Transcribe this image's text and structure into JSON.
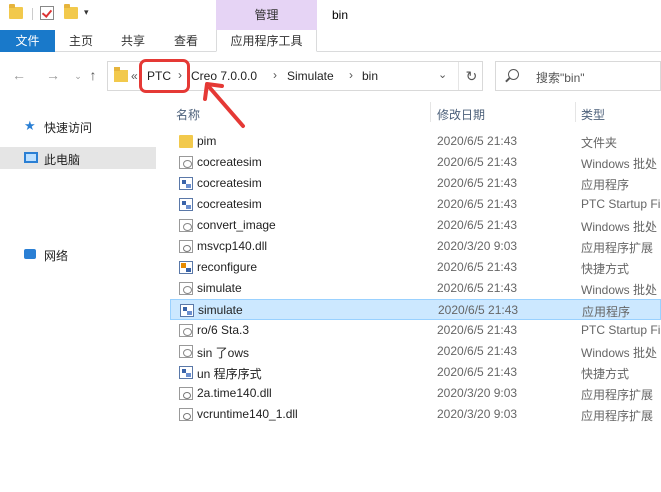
{
  "titlebar": {
    "manage_tab": "管理",
    "window_title": "bin"
  },
  "ribbon": {
    "tabs": [
      "文件",
      "主页",
      "共享",
      "查看",
      "应用程序工具"
    ]
  },
  "address": {
    "overflow": "«",
    "segments": [
      "PTC",
      "Creo 7.0.0.0",
      "Simulate",
      "bin"
    ],
    "search_placeholder": "搜索\"bin\""
  },
  "sidebar": {
    "items": [
      {
        "label": "快速访问",
        "icon": "star-icon"
      },
      {
        "label": "此电脑",
        "icon": "computer-icon",
        "selected": true
      },
      {
        "label": "网络",
        "icon": "network-icon"
      }
    ]
  },
  "columns": {
    "name": "名称",
    "date": "修改日期",
    "type": "类型"
  },
  "files": [
    {
      "name": "pim",
      "date": "2020/6/5 21:43",
      "type": "文件夹",
      "icon": "folder"
    },
    {
      "name": "cocreatesim",
      "date": "2020/6/5 21:43",
      "type": "Windows 批处",
      "icon": "script"
    },
    {
      "name": "cocreatesim",
      "date": "2020/6/5 21:43",
      "type": "应用程序",
      "icon": "app"
    },
    {
      "name": "cocreatesim",
      "date": "2020/6/5 21:43",
      "type": "PTC Startup Fi",
      "icon": "app"
    },
    {
      "name": "convert_image",
      "date": "2020/6/5 21:43",
      "type": "Windows 批处",
      "icon": "script"
    },
    {
      "name": "msvcp140.dll",
      "date": "2020/3/20 9:03",
      "type": "应用程序扩展",
      "icon": "dll"
    },
    {
      "name": "reconfigure",
      "date": "2020/6/5 21:43",
      "type": "快捷方式",
      "icon": "shortcut"
    },
    {
      "name": "simulate",
      "date": "2020/6/5 21:43",
      "type": "Windows 批处",
      "icon": "script"
    },
    {
      "name": "simulate",
      "date": "2020/6/5 21:43",
      "type": "应用程序",
      "icon": "app",
      "selected": true
    },
    {
      "name": "ro/6 Sta.3",
      "date": "2020/6/5 21:43",
      "type": "PTC Startup Fi",
      "icon": "script"
    },
    {
      "name": "sin 了ows",
      "date": "2020/6/5 21:43",
      "type": "Windows 批处",
      "icon": "script"
    },
    {
      "name": "un 程序序式",
      "date": "2020/6/5 21:43",
      "type": "快捷方式",
      "icon": "app"
    },
    {
      "name": "2a.time140.dll",
      "date": "2020/3/20 9:03",
      "type": "应用程序扩展",
      "icon": "dll"
    },
    {
      "name": "vcruntime140_1.dll",
      "date": "2020/3/20 9:03",
      "type": "应用程序扩展",
      "icon": "dll"
    }
  ],
  "colors": {
    "accent": "#1979ca",
    "manage_tab_bg": "#e6d4f5",
    "selection_bg": "#cce8ff",
    "highlight": "#e53935"
  }
}
